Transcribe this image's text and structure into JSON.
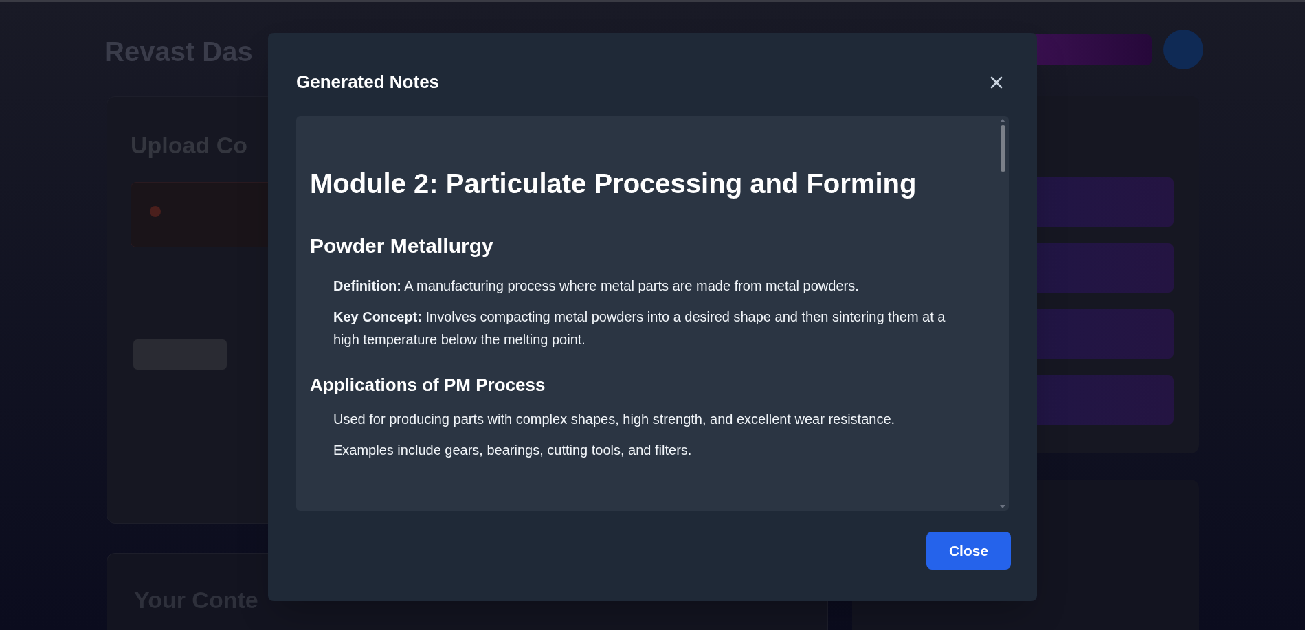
{
  "background": {
    "title": "Revast Das",
    "cards": [
      {
        "heading": "Upload Co"
      },
      {
        "heading": "Your Conte"
      }
    ]
  },
  "modal": {
    "title": "Generated Notes",
    "notes": [
      {
        "kind": "h1",
        "text": "Module 2: Particulate Processing and Forming"
      },
      {
        "kind": "h2",
        "text": "Powder Metallurgy"
      },
      {
        "kind": "p",
        "text": "**Definition:** A manufacturing process where metal parts are made from metal powders."
      },
      {
        "kind": "p",
        "text": "**Key Concept:** Involves compacting metal powders into a desired shape and then sintering them at a high temperature below the melting point."
      },
      {
        "kind": "h3",
        "text": "Applications of PM Process"
      },
      {
        "kind": "p",
        "text": "Used for producing parts with complex shapes, high strength, and excellent wear resistance."
      },
      {
        "kind": "p",
        "text": "Examples include gears, bearings, cutting tools, and filters."
      }
    ],
    "button": "Close"
  }
}
